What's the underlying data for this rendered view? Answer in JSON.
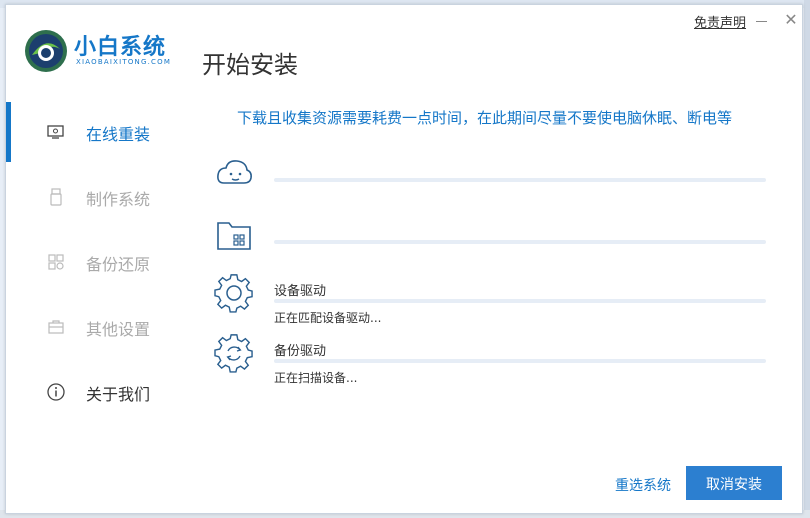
{
  "app": {
    "brand_name": "小白系统",
    "brand_sub": "XIAOBAIXITONG.COM",
    "page_title": "开始安装",
    "disclaimer": "免责声明",
    "accent_color": "#1577c8"
  },
  "sidebar": {
    "items": [
      {
        "label": "在线重装",
        "icon": "monitor-icon",
        "state": "active"
      },
      {
        "label": "制作系统",
        "icon": "usb-icon",
        "state": "disabled"
      },
      {
        "label": "备份还原",
        "icon": "grid-icon",
        "state": "disabled"
      },
      {
        "label": "其他设置",
        "icon": "briefcase-icon",
        "state": "disabled"
      },
      {
        "label": "关于我们",
        "icon": "info-icon",
        "state": "normal"
      }
    ]
  },
  "main": {
    "notice": "下载且收集资源需要耗费一点时间，在此期间尽量不要使电脑休眠、断电等",
    "steps": [
      {
        "icon": "cloud-icon",
        "title": "",
        "status": "",
        "progress": 0
      },
      {
        "icon": "folder-icon",
        "title": "",
        "status": "",
        "progress": 0
      },
      {
        "icon": "gear-icon",
        "title": "设备驱动",
        "status": "正在匹配设备驱动...",
        "progress": 0
      },
      {
        "icon": "gear-sync-icon",
        "title": "备份驱动",
        "status": "正在扫描设备...",
        "progress": 0
      }
    ]
  },
  "footer": {
    "reselect_label": "重选系统",
    "cancel_label": "取消安装"
  }
}
